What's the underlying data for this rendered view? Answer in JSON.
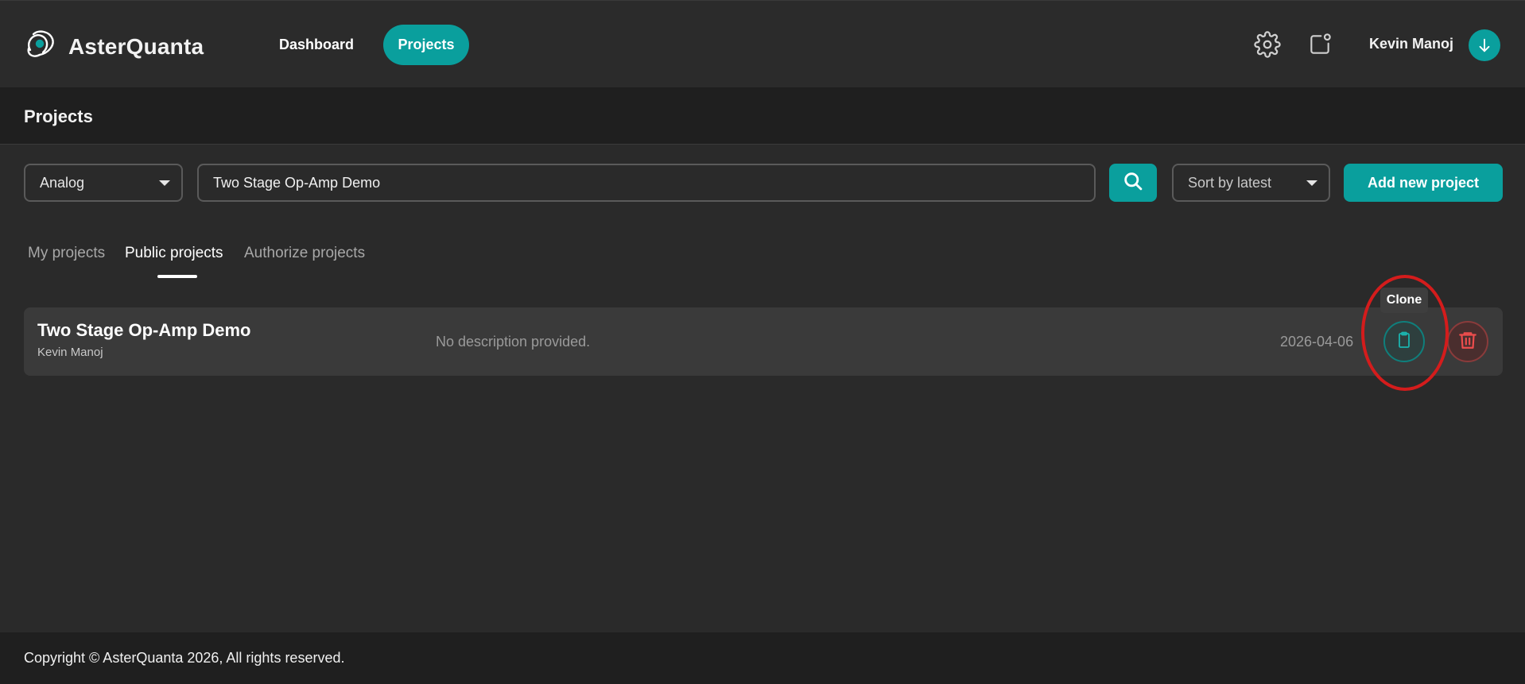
{
  "app": {
    "name": "AsterQuanta",
    "accent_color": "#0a9f9d",
    "danger_color": "#e04848"
  },
  "nav": {
    "dashboard_label": "Dashboard",
    "projects_label": "Projects",
    "active": "Projects"
  },
  "user": {
    "name": "Kevin Manoj",
    "avatar_icon": "download-arrow-icon"
  },
  "header_icons": [
    "gear-icon",
    "notification-icon"
  ],
  "page": {
    "title": "Projects"
  },
  "filters": {
    "type_selected": "Analog",
    "search_value": "Two Stage Op-Amp Demo",
    "sort_selected": "Sort by latest",
    "add_label": "Add new project"
  },
  "tabs": [
    {
      "label": "My projects",
      "active": false
    },
    {
      "label": "Public projects",
      "active": true
    },
    {
      "label": "Authorize projects",
      "active": false
    }
  ],
  "projects": [
    {
      "title": "Two Stage Op-Amp Demo",
      "author": "Kevin Manoj",
      "description": "No description provided.",
      "date": "2026-04-06",
      "actions": [
        "clone-icon",
        "trash-icon"
      ]
    }
  ],
  "tooltip": {
    "text": "Clone"
  },
  "footer": {
    "text": "Copyright © AsterQuanta 2026, All rights reserved."
  }
}
